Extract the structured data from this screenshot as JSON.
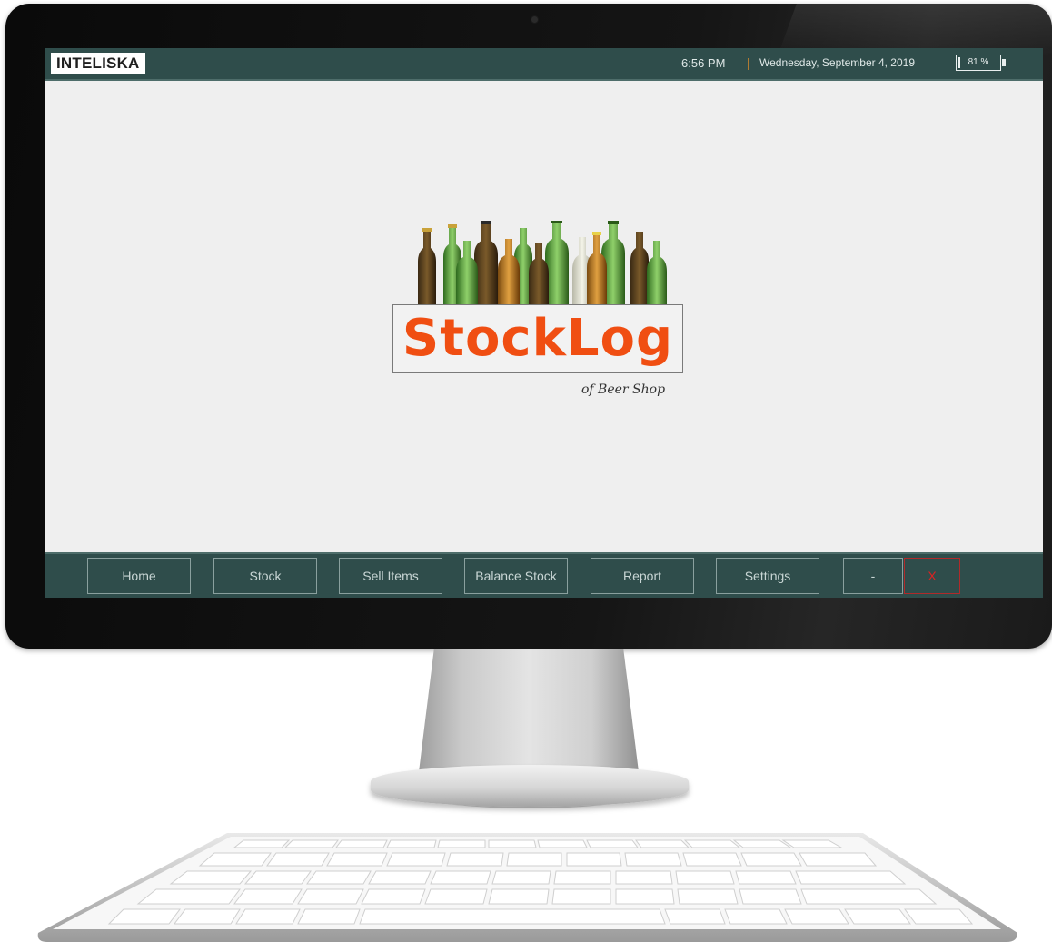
{
  "topbar": {
    "logo_text": "INTELISKA",
    "time": "6:56 PM",
    "separator": "|",
    "date": "Wednesday, September 4, 2019",
    "battery_percent": "81 %"
  },
  "splash": {
    "title": "StockLog",
    "subtitle": "of Beer Shop",
    "title_color": "#f04e12"
  },
  "nav": {
    "home": "Home",
    "stock": "Stock",
    "sell_items": "Sell Items",
    "balance_stock": "Balance Stock",
    "report": "Report",
    "settings": "Settings",
    "minimize": "-",
    "close": "X"
  },
  "colors": {
    "bar": "#2f4d4b",
    "screen_bg": "#efefef",
    "close_accent": "#d22222"
  }
}
